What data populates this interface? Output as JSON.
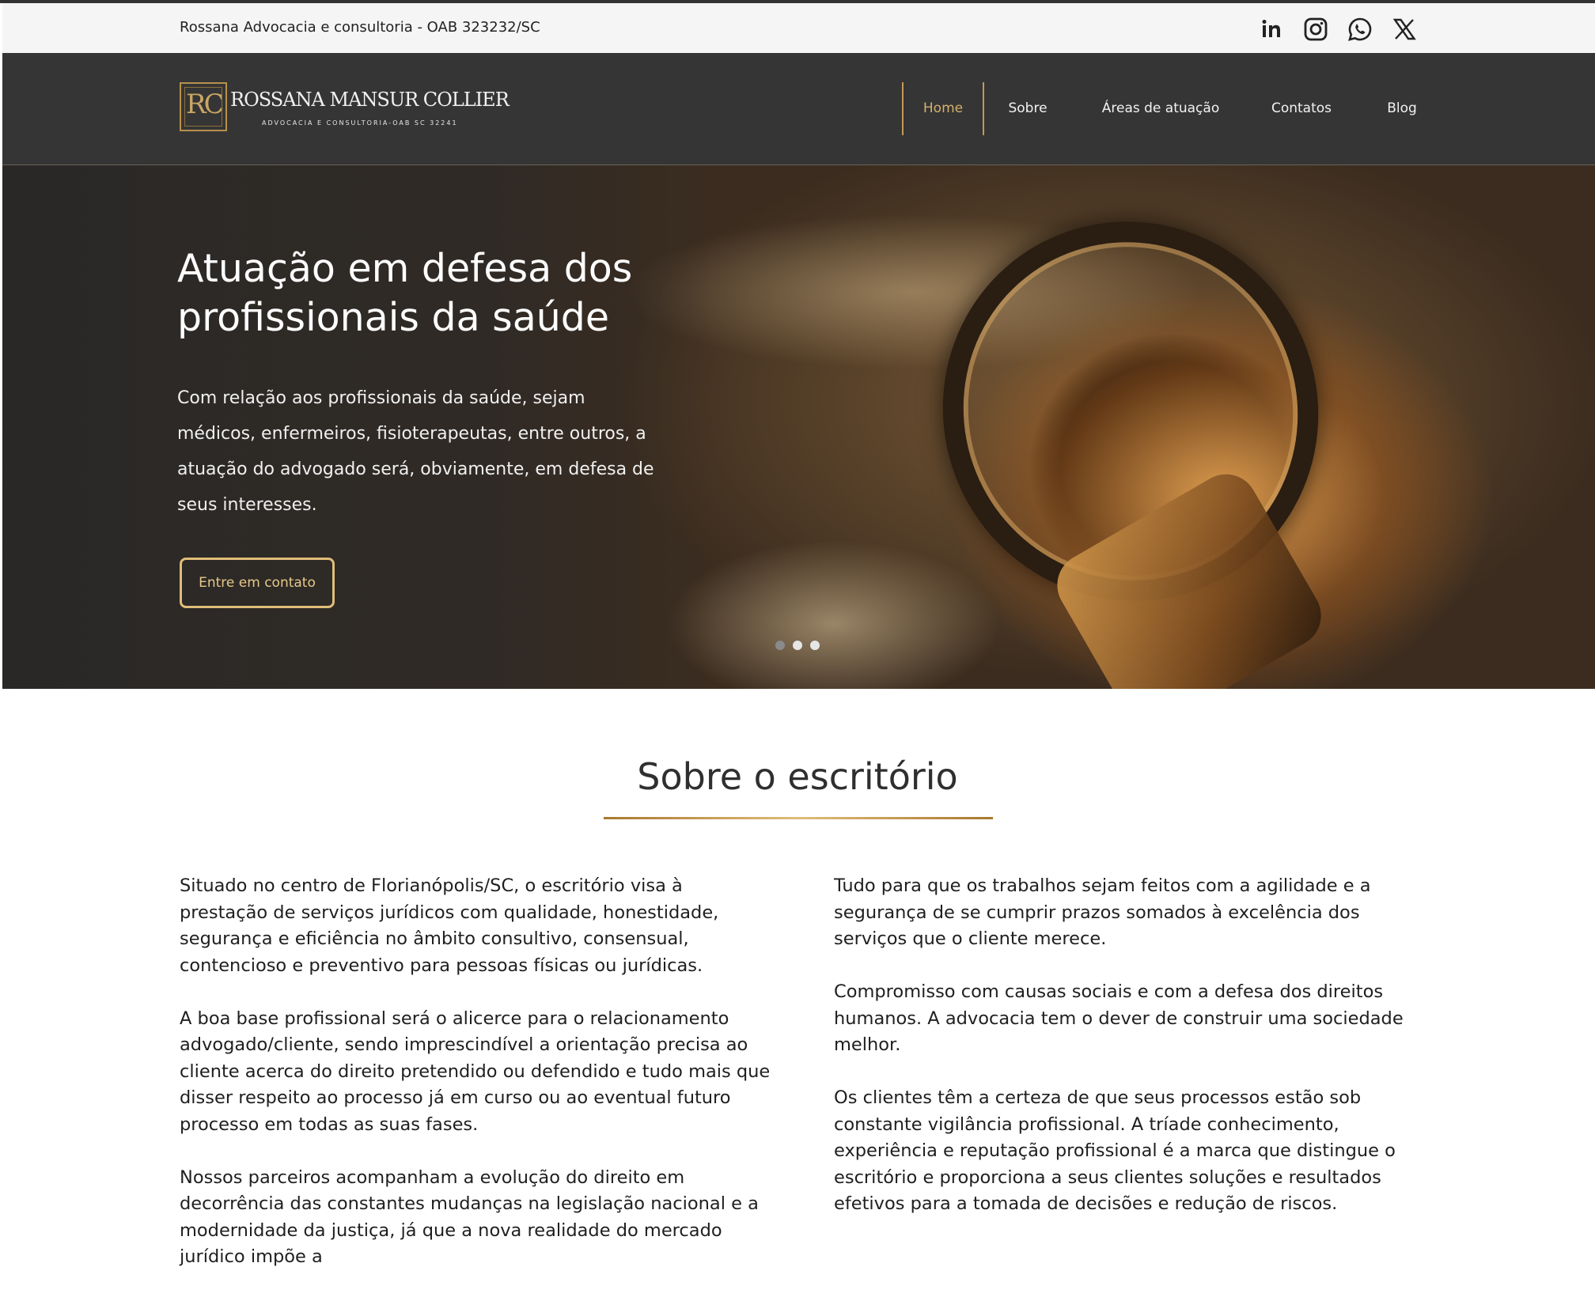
{
  "topbar": {
    "info": "Rossana Advocacia e consultoria - OAB 323232/SC",
    "social": [
      "linkedin-icon",
      "instagram-icon",
      "whatsapp-icon",
      "x-icon"
    ]
  },
  "brand": {
    "monogram": "RC",
    "name": "ROSSANA MANSUR COLLIER",
    "subtitle": "ADVOCACIA E CONSULTORIA-OAB SC 32241"
  },
  "nav": {
    "items": [
      {
        "label": "Home",
        "active": true
      },
      {
        "label": "Sobre",
        "active": false
      },
      {
        "label": "Áreas de atuação",
        "active": false
      },
      {
        "label": "Contatos",
        "active": false
      },
      {
        "label": "Blog",
        "active": false
      }
    ]
  },
  "hero": {
    "title": "Atuação em defesa dos profissionais da saúde",
    "text": "Com relação aos profissionais da saúde, sejam médicos, enfermeiros, fisioterapeutas, entre outros, a atuação do advogado será, obviamente, em defesa de seus interesses.",
    "cta_label": "Entre em contato",
    "slides": 3,
    "current_slide": 1
  },
  "about": {
    "title": "Sobre o escritório",
    "left": [
      "Situado  no centro de Florianópolis/SC, o escritório   visa à prestação de serviços jurídicos com qualidade, honestidade,  segurança e eficiência  no âmbito consultivo, consensual, contencioso e preventivo para pessoas físicas  ou jurídicas.",
      "A  boa base profissional será o alicerce para o relacionamento advogado/cliente,  sendo imprescindível a orientação precisa ao cliente  acerca do direito  pretendido ou defendido e tudo mais que disser  respeito ao processo já em curso  ou ao eventual futuro processo em  todas as suas fases.",
      "Nossos  parceiros acompanham a evolução do direito em decorrência das  constantes  mudanças na legislação nacional e a modernidade da justiça,  já que a nova  realidade do mercado jurídico impõe a"
    ],
    "right": [
      "Tudo  para que os trabalhos sejam feitos  com a agilidade e a segurança de se  cumprir prazos somados à excelência dos serviços que o cliente  merece.",
      "Compromisso  com causas sociais e com a defesa dos direitos humanos. A advocacia tem o dever de construir uma sociedade melhor.",
      "Os  clientes têm a certeza de que seus processos estão sob constante vigilância  profissional. A tríade conhecimento,  experiência e reputação profissional  é a marca que distingue o escritório e proporciona a seus clientes  soluções e resultados efetivos para a tomada de  decisões e redução de  riscos."
    ]
  },
  "colors": {
    "accent": "#c49a54",
    "nav_bg": "#353535",
    "topbar_bg": "#f5f5f5"
  }
}
